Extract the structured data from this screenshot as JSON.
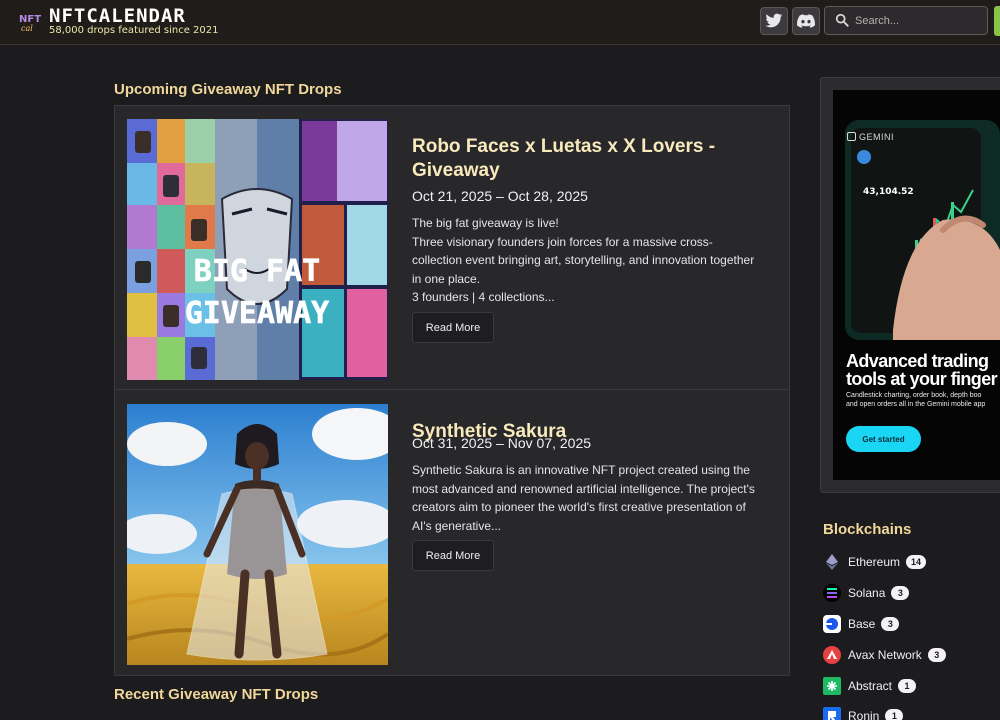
{
  "header": {
    "brand": "NFTCALENDAR",
    "tagline": "58,000 drops featured since 2021",
    "logo_icon": "nft-calendar-logo",
    "social_icons": [
      "twitter-icon",
      "discord-icon"
    ],
    "search": {
      "placeholder": "Search..."
    }
  },
  "main": {
    "upcoming_title": "Upcoming Giveaway NFT Drops",
    "recent_title": "Recent Giveaway NFT Drops",
    "cards": [
      {
        "title": "Robo Faces x Luetas x X Lovers - Giveaway",
        "dates": "Oct 21, 2025 – Oct 28, 2025",
        "description": [
          "The big fat giveaway is live!",
          "Three visionary founders join forces for a massive cross-collection event bringing art, storytelling, and innovation together in one place.",
          "3 founders | 4 collections..."
        ],
        "image_text": [
          "BIG FAT",
          "GIVEAWAY"
        ],
        "button": "Read More"
      },
      {
        "title": "Synthetic Sakura",
        "dates": "Oct 31, 2025 – Nov 07, 2025",
        "description": [
          "Synthetic Sakura is an innovative NFT project created using the most advanced and renowned artificial intelligence. The project's creators aim to pioneer the world's first creative presentation of AI's generative..."
        ],
        "button": "Read More"
      }
    ]
  },
  "ad": {
    "brand": "GEMINI",
    "phone_value": "43,104.52",
    "headline_1": "Advanced trading",
    "headline_2": "tools at your finger",
    "sub_1": "Candlestick charting, order book, depth boo",
    "sub_2": "and open orders all in the Gemini mobile app",
    "cta": "Get started"
  },
  "blockchains": {
    "title": "Blockchains",
    "items": [
      {
        "name": "Ethereum",
        "count": "14",
        "icon": "ethereum-icon"
      },
      {
        "name": "Solana",
        "count": "3",
        "icon": "solana-icon"
      },
      {
        "name": "Base",
        "count": "3",
        "icon": "base-icon"
      },
      {
        "name": "Avax Network",
        "count": "3",
        "icon": "avalanche-icon"
      },
      {
        "name": "Abstract",
        "count": "1",
        "icon": "abstract-icon"
      },
      {
        "name": "Ronin",
        "count": "1",
        "icon": "ronin-icon"
      }
    ]
  },
  "colors": {
    "background": "#1c1b1e",
    "card_panel": "#28272a",
    "accent_gold": "#f0d79a",
    "ad_cta": "#19d6f5"
  }
}
